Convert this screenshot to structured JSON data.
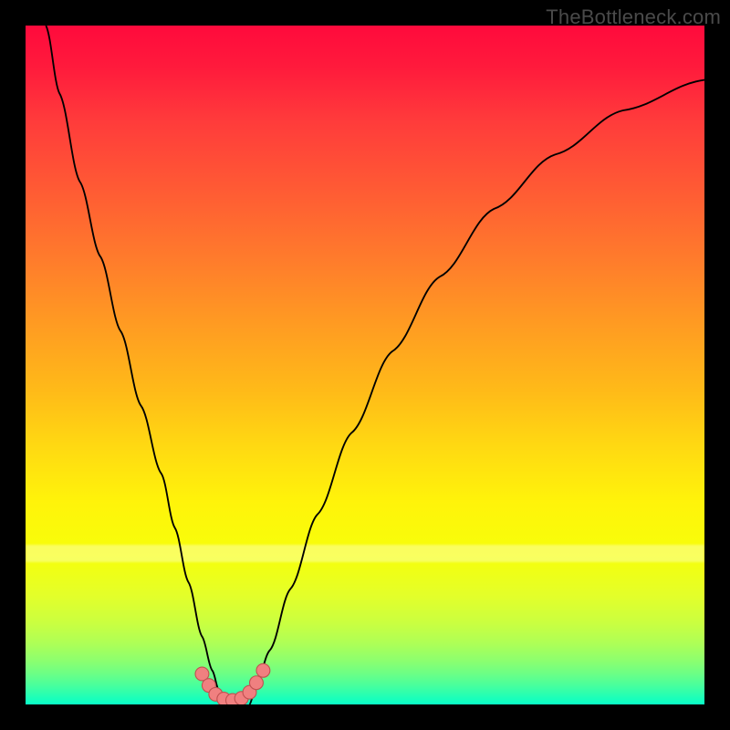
{
  "watermark": "TheBottleneck.com",
  "colors": {
    "frame": "#000000",
    "curve": "#000000",
    "marker_fill": "#f08080",
    "marker_stroke": "#c05050"
  },
  "chart_data": {
    "type": "line",
    "title": "",
    "xlabel": "",
    "ylabel": "",
    "xlim": [
      0,
      100
    ],
    "ylim": [
      0,
      100
    ],
    "grid": false,
    "legend": false,
    "series": [
      {
        "name": "left-branch",
        "x": [
          3,
          5,
          8,
          11,
          14,
          17,
          20,
          22,
          24,
          26,
          27.5,
          28.5,
          29
        ],
        "values": [
          100,
          90,
          77,
          66,
          55,
          44,
          34,
          26,
          18,
          10,
          5,
          2,
          0
        ]
      },
      {
        "name": "right-branch",
        "x": [
          33,
          34,
          36,
          39,
          43,
          48,
          54,
          61,
          69,
          78,
          88,
          100
        ],
        "values": [
          0,
          3,
          8,
          17,
          28,
          40,
          52,
          63,
          73,
          81,
          87.5,
          92
        ]
      }
    ],
    "markers": {
      "name": "bottom-cluster",
      "points": [
        {
          "x": 26.0,
          "y": 4.5
        },
        {
          "x": 27.0,
          "y": 2.8
        },
        {
          "x": 28.0,
          "y": 1.5
        },
        {
          "x": 29.2,
          "y": 0.8
        },
        {
          "x": 30.5,
          "y": 0.6
        },
        {
          "x": 31.8,
          "y": 0.9
        },
        {
          "x": 33.0,
          "y": 1.8
        },
        {
          "x": 34.0,
          "y": 3.2
        },
        {
          "x": 35.0,
          "y": 5.0
        }
      ],
      "radius": 1.0
    },
    "lightband_y_pct": 76.5
  }
}
